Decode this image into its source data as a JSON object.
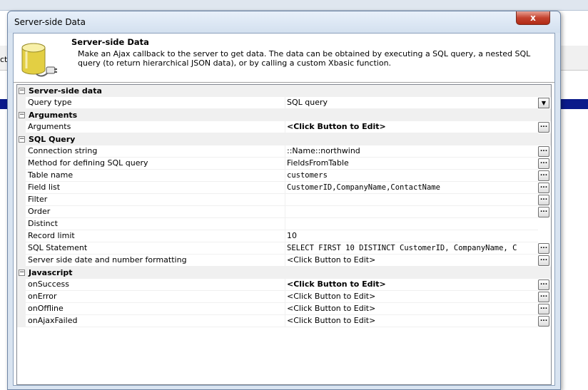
{
  "background": {
    "clipped_text": "cti"
  },
  "window": {
    "title": "Server-side Data",
    "close_glyph": "x"
  },
  "header": {
    "title": "Server-side Data",
    "description": "Make an Ajax callback to the server to get data. The data can be obtained by executing a SQL query, a nested SQL query (to return hierarchical JSON data), or by calling a custom Xbasic function."
  },
  "grid": {
    "server_side_data": {
      "label": "Server-side data",
      "query_type": {
        "name": "Query type",
        "value": "SQL query"
      }
    },
    "arguments": {
      "label": "Arguments",
      "arguments": {
        "name": "Arguments",
        "value": "<Click Button to Edit>"
      }
    },
    "sql_query": {
      "label": "SQL Query",
      "connection_string": {
        "name": "Connection string",
        "value": "::Name::northwind"
      },
      "method": {
        "name": "Method for defining SQL query",
        "value": "FieldsFromTable"
      },
      "table_name": {
        "name": "Table name",
        "value": "customers"
      },
      "field_list": {
        "name": "Field list",
        "value": "CustomerID,CompanyName,ContactName"
      },
      "filter": {
        "name": "Filter",
        "value": ""
      },
      "order": {
        "name": "Order",
        "value": ""
      },
      "distinct": {
        "name": "Distinct",
        "value": ""
      },
      "record_limit": {
        "name": "Record limit",
        "value": "10"
      },
      "sql_statement": {
        "name": "SQL Statement",
        "value": "SELECT FIRST 10 DISTINCT CustomerID, CompanyName, C"
      },
      "formatting": {
        "name": "Server side date and number formatting",
        "value": "<Click Button to Edit>"
      }
    },
    "javascript": {
      "label": "Javascript",
      "on_success": {
        "name": "onSuccess",
        "value": "<Click Button to Edit>"
      },
      "on_error": {
        "name": "onError",
        "value": "<Click Button to Edit>"
      },
      "on_offline": {
        "name": "onOffline",
        "value": "<Click Button to Edit>"
      },
      "on_ajax_failed": {
        "name": "onAjaxFailed",
        "value": "<Click Button to Edit>"
      }
    }
  },
  "glyphs": {
    "ellipsis": "...",
    "dropdown": "▼",
    "collapse": "−"
  }
}
